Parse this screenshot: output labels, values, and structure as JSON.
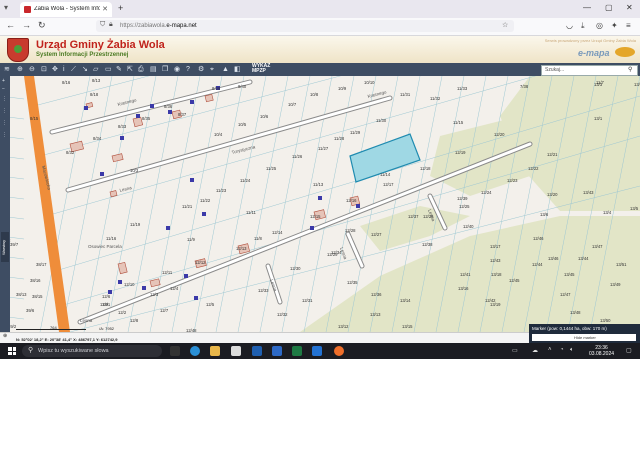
{
  "browser": {
    "tab_title": "Żabia Wola - System Informacji",
    "url_prefix": "https://zabiawola.",
    "url_domain": "e-mapa.net"
  },
  "header": {
    "title": "Urząd Gminy Żabia Wola",
    "subtitle": "System Informacji Przestrzennej",
    "right_text": "Serwis prowadzony przez Urząd Gminy Żabia Wola",
    "brand": "e-mapa"
  },
  "toolbar": {
    "wykaz_line1": "WYKAZ",
    "wykaz_line2": "MPZP",
    "search_placeholder": "Szukaj..."
  },
  "left_panel": {
    "layers_label": "Warstwy"
  },
  "map": {
    "street_labels": [
      "Krasnego",
      "Turystyczna",
      "Lesna",
      "Krasnego",
      "Mazowiecka",
      "Lesna",
      "Lesna",
      "Lesna",
      "Lesna"
    ],
    "district_label": "Osowiec Parcela",
    "parcels": [
      {
        "label": "8/16"
      },
      {
        "label": "8/18"
      },
      {
        "label": "8/15"
      },
      {
        "label": "8/34"
      },
      {
        "label": "8/33"
      },
      {
        "label": "8/35"
      },
      {
        "label": "8/36"
      },
      {
        "label": "8/37"
      },
      {
        "label": "8/39"
      },
      {
        "label": "8/40"
      },
      {
        "label": "8/32"
      },
      {
        "label": "10/4"
      },
      {
        "label": "10/3"
      },
      {
        "label": "10/5"
      },
      {
        "label": "10/6"
      },
      {
        "label": "10/7"
      },
      {
        "label": "10/8"
      },
      {
        "label": "10/9"
      },
      {
        "label": "10/10"
      },
      {
        "label": "11/31"
      },
      {
        "label": "11/32"
      },
      {
        "label": "11/33"
      },
      {
        "label": "11/30"
      },
      {
        "label": "11/15"
      },
      {
        "label": "11/29"
      },
      {
        "label": "11/28"
      },
      {
        "label": "11/27"
      },
      {
        "label": "11/26"
      },
      {
        "label": "11/25"
      },
      {
        "label": "11/24"
      },
      {
        "label": "11/23"
      },
      {
        "label": "11/22"
      },
      {
        "label": "11/21"
      },
      {
        "label": "11/11"
      },
      {
        "label": "11/13"
      },
      {
        "label": "11/14"
      },
      {
        "label": "11/16"
      },
      {
        "label": "11/9"
      },
      {
        "label": "11/8"
      },
      {
        "label": "11/19"
      },
      {
        "label": "12/20"
      },
      {
        "label": "12/19"
      },
      {
        "label": "12/18"
      },
      {
        "label": "12/17"
      },
      {
        "label": "12/16"
      },
      {
        "label": "12/15"
      },
      {
        "label": "12/14"
      },
      {
        "label": "12/13"
      },
      {
        "label": "12/12"
      },
      {
        "label": "12/11"
      },
      {
        "label": "12/10"
      },
      {
        "label": "12/9"
      },
      {
        "label": "12/8"
      },
      {
        "label": "12/7"
      },
      {
        "label": "12/6"
      },
      {
        "label": "12/21"
      },
      {
        "label": "12/22"
      },
      {
        "label": "12/23"
      },
      {
        "label": "12/24"
      },
      {
        "label": "12/25"
      },
      {
        "label": "12/26"
      },
      {
        "label": "12/27"
      },
      {
        "label": "12/28"
      },
      {
        "label": "12/29"
      },
      {
        "label": "12/30"
      },
      {
        "label": "12/31"
      },
      {
        "label": "12/32"
      },
      {
        "label": "12/33"
      },
      {
        "label": "12/34"
      },
      {
        "label": "12/35"
      },
      {
        "label": "12/36"
      },
      {
        "label": "12/37"
      },
      {
        "label": "12/38"
      },
      {
        "label": "12/39"
      },
      {
        "label": "12/40"
      },
      {
        "label": "12/41"
      },
      {
        "label": "12/42"
      },
      {
        "label": "12/43"
      },
      {
        "label": "12/44"
      },
      {
        "label": "12/45"
      },
      {
        "label": "12/46"
      },
      {
        "label": "12/47"
      },
      {
        "label": "12/48"
      },
      {
        "label": "13/1"
      },
      {
        "label": "13/2"
      },
      {
        "label": "13/3"
      },
      {
        "label": "13/4"
      },
      {
        "label": "13/5"
      },
      {
        "label": "13/6"
      },
      {
        "label": "13/12"
      },
      {
        "label": "13/13"
      },
      {
        "label": "13/14"
      },
      {
        "label": "13/15"
      },
      {
        "label": "13/16"
      },
      {
        "label": "13/17"
      },
      {
        "label": "13/18"
      },
      {
        "label": "13/19"
      },
      {
        "label": "13/20"
      },
      {
        "label": "13/43"
      },
      {
        "label": "13/44"
      },
      {
        "label": "13/45"
      },
      {
        "label": "13/46"
      },
      {
        "label": "13/47"
      },
      {
        "label": "13/48"
      },
      {
        "label": "13/49"
      },
      {
        "label": "13/50"
      },
      {
        "label": "13/51"
      },
      {
        "label": "11/7"
      },
      {
        "label": "7/38"
      },
      {
        "label": "8/13"
      },
      {
        "label": "38/17"
      },
      {
        "label": "38/16"
      },
      {
        "label": "38/15"
      },
      {
        "label": "38/12"
      },
      {
        "label": "39/5"
      },
      {
        "label": "38/13"
      },
      {
        "label": "39/1"
      },
      {
        "label": "39/2"
      },
      {
        "label": "39/6"
      },
      {
        "label": "39/7"
      },
      {
        "label": "12/1"
      },
      {
        "label": "12/2"
      },
      {
        "label": "12/3"
      },
      {
        "label": "12/4"
      },
      {
        "label": "12/5"
      }
    ]
  },
  "statusbar": {
    "coords": "N: 52°02' 18,2\"  E: 20°38' 41,4\"   X: 486797,1  Y: 612742,9",
    "scale_left": "764",
    "scale_right": "/A: 7952",
    "marker": "Marker (pow: 0,1444 ha, obw: 170 m)",
    "marker_sub": "Hide marker"
  },
  "taskbar": {
    "search_placeholder": "Wpisz tu wyszukiwane słowa",
    "time": "23:36",
    "date": "03.08.2024"
  }
}
